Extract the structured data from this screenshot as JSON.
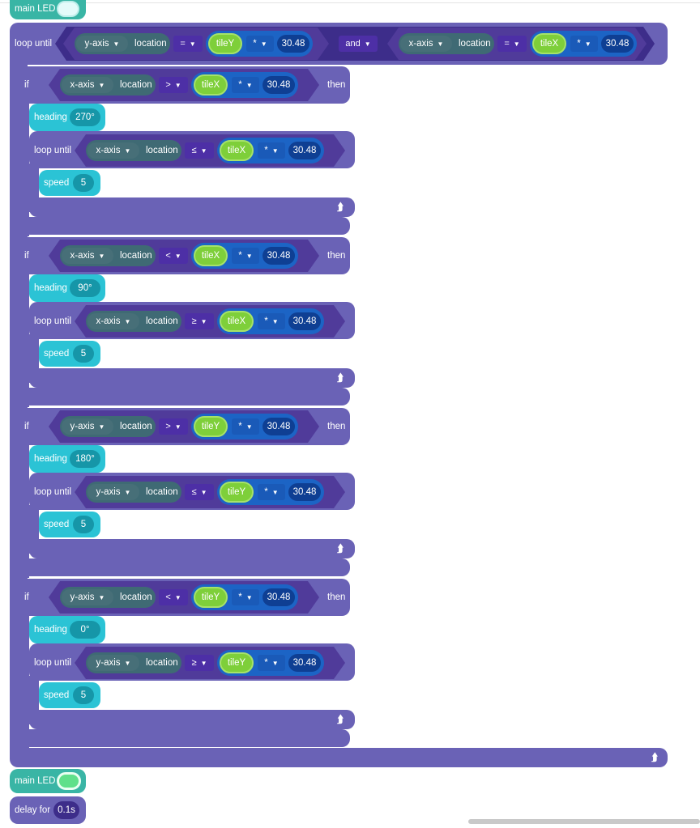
{
  "labels": {
    "main_led": "main LED",
    "loop_until": "loop until",
    "if": "if",
    "then": "then",
    "and": "and",
    "location": "location",
    "heading": "heading",
    "speed": "speed",
    "delay_for": "delay for"
  },
  "top": {
    "left": {
      "axis": "y-axis",
      "op": "=",
      "var": "tileY",
      "math_op": "*",
      "value": "30.48"
    },
    "right": {
      "axis": "x-axis",
      "op": "=",
      "var": "tileX",
      "math_op": "*",
      "value": "30.48"
    }
  },
  "ifs": [
    {
      "cond": {
        "axis": "x-axis",
        "op": ">",
        "var": "tileX",
        "math_op": "*",
        "value": "30.48"
      },
      "heading": "270°",
      "until": {
        "axis": "x-axis",
        "op": "≤",
        "var": "tileX",
        "math_op": "*",
        "value": "30.48"
      },
      "speed": "5"
    },
    {
      "cond": {
        "axis": "x-axis",
        "op": "<",
        "var": "tileX",
        "math_op": "*",
        "value": "30.48"
      },
      "heading": "90°",
      "until": {
        "axis": "x-axis",
        "op": "≥",
        "var": "tileX",
        "math_op": "*",
        "value": "30.48"
      },
      "speed": "5"
    },
    {
      "cond": {
        "axis": "y-axis",
        "op": ">",
        "var": "tileY",
        "math_op": "*",
        "value": "30.48"
      },
      "heading": "180°",
      "until": {
        "axis": "y-axis",
        "op": "≤",
        "var": "tileY",
        "math_op": "*",
        "value": "30.48"
      },
      "speed": "5"
    },
    {
      "cond": {
        "axis": "y-axis",
        "op": "<",
        "var": "tileY",
        "math_op": "*",
        "value": "30.48"
      },
      "heading": "0°",
      "until": {
        "axis": "y-axis",
        "op": "≥",
        "var": "tileY",
        "math_op": "*",
        "value": "30.48"
      },
      "speed": "5"
    }
  ],
  "delay": "0.1s",
  "colors": {
    "loop": "#6a62b6",
    "cyan": "#2bc3d5",
    "teal": "#39b5a5",
    "boolean": "#503b9a",
    "math": "#1c64c5",
    "variable": "#7ecf3a"
  }
}
